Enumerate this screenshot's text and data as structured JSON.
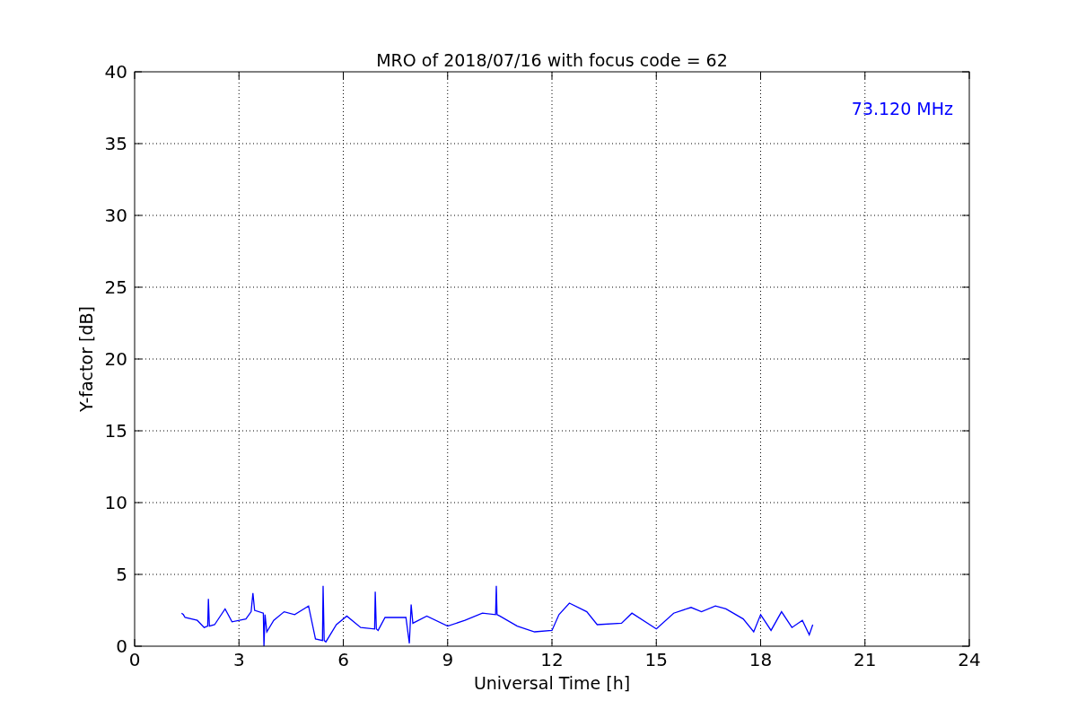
{
  "chart_data": {
    "type": "line",
    "title": "MRO of 2018/07/16 with focus code = 62",
    "xlabel": "Universal Time [h]",
    "ylabel": "Y-factor [dB]",
    "x": [
      1.35,
      1.4,
      1.45,
      1.8,
      2.0,
      2.1,
      2.12,
      2.15,
      2.3,
      2.6,
      2.8,
      3.2,
      3.35,
      3.4,
      3.45,
      3.7,
      3.72,
      3.75,
      3.8,
      4.0,
      4.3,
      4.6,
      5.0,
      5.2,
      5.4,
      5.42,
      5.45,
      5.5,
      5.8,
      6.1,
      6.5,
      6.9,
      6.92,
      6.95,
      7.0,
      7.2,
      7.8,
      7.9,
      7.95,
      8.0,
      8.4,
      9.0,
      9.5,
      10.0,
      10.38,
      10.4,
      10.42,
      10.5,
      11.0,
      11.5,
      12.0,
      12.2,
      12.5,
      13.0,
      13.3,
      14.0,
      14.3,
      15.0,
      15.5,
      16.0,
      16.3,
      16.7,
      17.0,
      17.5,
      17.8,
      18.0,
      18.3,
      18.6,
      18.9,
      19.2,
      19.4,
      19.5
    ],
    "series": [
      {
        "color": "#0000ff",
        "values": [
          2.3,
          2.2,
          2.0,
          1.8,
          1.3,
          1.4,
          3.3,
          1.4,
          1.5,
          2.6,
          1.7,
          1.9,
          2.4,
          3.7,
          2.5,
          2.3,
          0.0,
          2.2,
          1.0,
          1.8,
          2.4,
          2.2,
          2.8,
          0.5,
          0.4,
          4.2,
          0.4,
          0.3,
          1.5,
          2.1,
          1.3,
          1.2,
          3.8,
          1.2,
          1.1,
          2.0,
          2.0,
          0.2,
          2.9,
          1.6,
          2.1,
          1.4,
          1.8,
          2.3,
          2.2,
          4.2,
          2.2,
          2.1,
          1.4,
          1.0,
          1.1,
          2.2,
          3.0,
          2.4,
          1.5,
          1.6,
          2.3,
          1.2,
          2.3,
          2.7,
          2.4,
          2.8,
          2.6,
          1.9,
          1.0,
          2.2,
          1.1,
          2.4,
          1.3,
          1.8,
          0.8,
          1.5
        ]
      }
    ],
    "xlim": [
      0,
      24
    ],
    "ylim": [
      0,
      40
    ],
    "xticks": [
      0,
      3,
      6,
      9,
      12,
      15,
      18,
      21,
      24
    ],
    "yticks": [
      0,
      5,
      10,
      15,
      20,
      25,
      30,
      35,
      40
    ],
    "grid": true,
    "annotations": [
      "73.120 MHz"
    ]
  }
}
